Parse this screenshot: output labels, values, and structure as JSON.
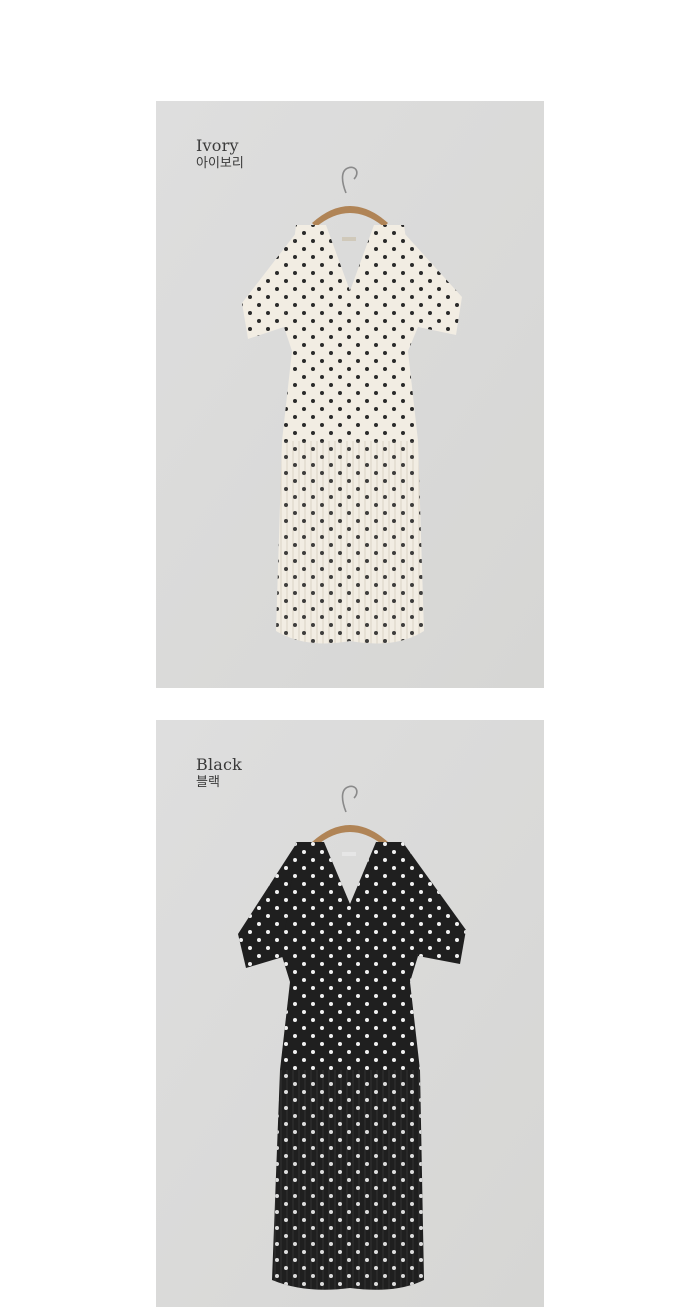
{
  "background": "#ffffff",
  "products": [
    {
      "color_en": "Ivory",
      "color_ko": "아이보리",
      "panel_color": "#dcdcda",
      "dress_color": "#f2ede3",
      "dot_color": "#2a2a2a",
      "hanger_icon": "wooden-hanger-icon"
    },
    {
      "color_en": "Black",
      "color_ko": "블랙",
      "panel_color": "#dcdcda",
      "dress_color": "#1f1f1f",
      "dot_color": "#f1f1f1",
      "hanger_icon": "wooden-hanger-icon"
    }
  ]
}
